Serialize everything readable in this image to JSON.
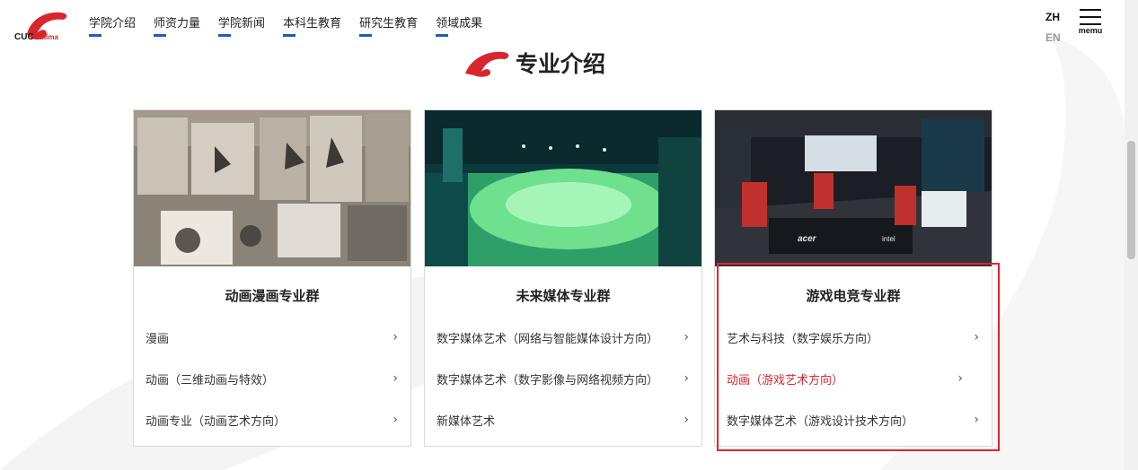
{
  "brand": {
    "logo_text_main": "CUC",
    "logo_text_sub": "Anima",
    "accent_color": "#d8262e",
    "nav_bar_color": "#1a5fb4"
  },
  "nav": {
    "items": [
      {
        "label": "学院介绍"
      },
      {
        "label": "师资力量"
      },
      {
        "label": "学院新闻"
      },
      {
        "label": "本科生教育"
      },
      {
        "label": "研究生教育"
      },
      {
        "label": "领域成果"
      }
    ]
  },
  "lang": {
    "zh": "ZH",
    "en": "EN"
  },
  "menu": {
    "label": "memu",
    "icon": "hamburger-icon"
  },
  "section": {
    "title": "专业介绍",
    "icon": "brand-swoosh-icon"
  },
  "cards": [
    {
      "title": "动画漫画专业群",
      "image": "animation-studio-wall-photo",
      "items": [
        {
          "label": "漫画",
          "active": false
        },
        {
          "label": "动画（三维动画与特效）",
          "active": false
        },
        {
          "label": "动画专业（动画艺术方向）",
          "active": false
        }
      ]
    },
    {
      "title": "未来媒体专业群",
      "image": "green-screen-studio-photo",
      "items": [
        {
          "label": "数字媒体艺术（网络与智能媒体设计方向）",
          "active": false
        },
        {
          "label": "数字媒体艺术（数字影像与网络视频方向）",
          "active": false
        },
        {
          "label": "新媒体艺术",
          "active": false
        }
      ]
    },
    {
      "title": "游戏电竞专业群",
      "image": "esports-arena-photo",
      "items": [
        {
          "label": "艺术与科技（数字娱乐方向）",
          "active": false
        },
        {
          "label": "动画（游戏艺术方向）",
          "active": true
        },
        {
          "label": "数字媒体艺术（游戏设计技术方向）",
          "active": false
        }
      ]
    }
  ],
  "chevron_glyph": "›"
}
